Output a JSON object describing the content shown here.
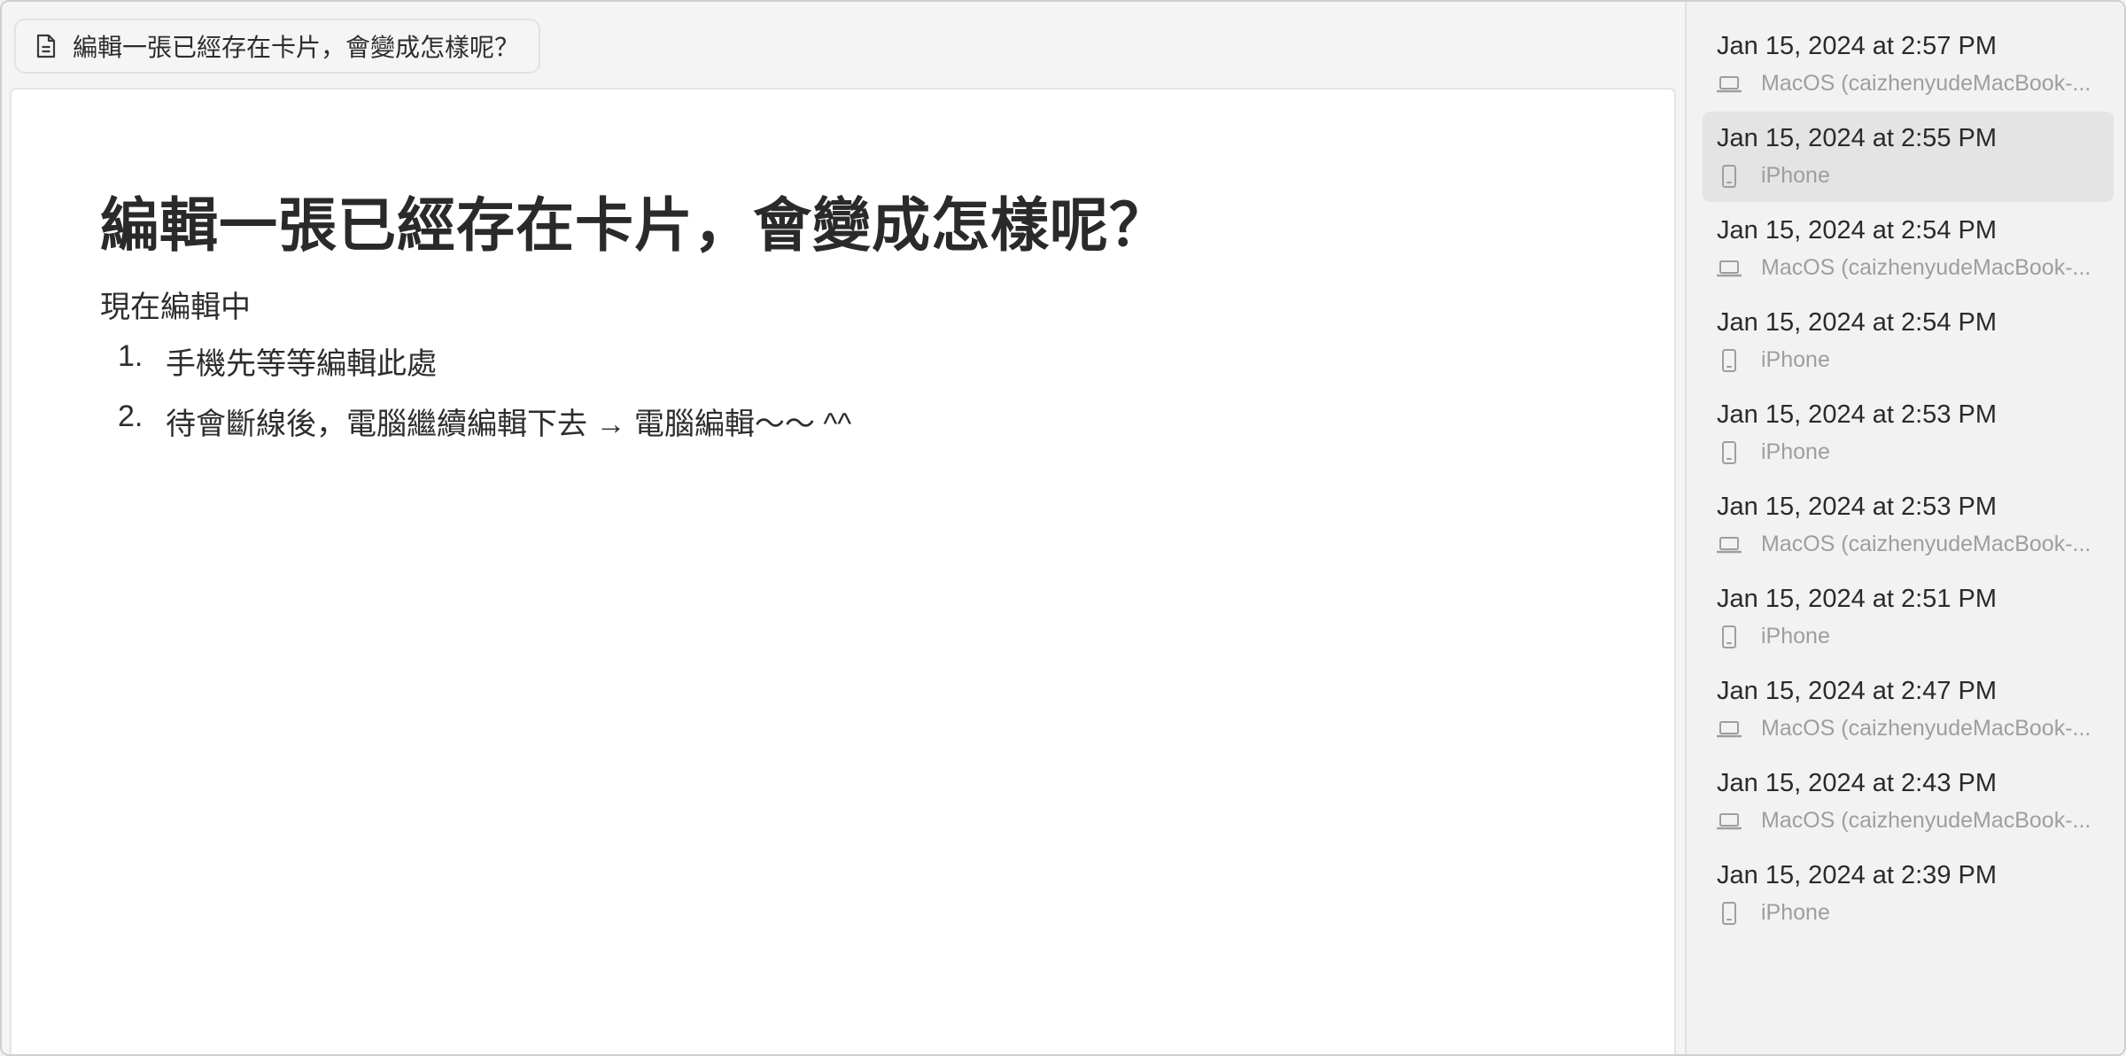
{
  "tab": {
    "title": "編輯一張已經存在卡片，會變成怎樣呢？",
    "icon": "document-icon"
  },
  "document": {
    "title": "編輯一張已經存在卡片，會變成怎樣呢？",
    "paragraph": "現在編輯中",
    "list": [
      {
        "num": "1.",
        "text": "手機先等等編輯此處"
      },
      {
        "num": "2.",
        "text": "待會斷線後，電腦繼續編輯下去 → 電腦編輯～～ ^^"
      }
    ]
  },
  "versions": [
    {
      "date": "Jan 15, 2024 at 2:57 PM",
      "device": "MacOS (caizhenyudeMacBook-...",
      "device_icon": "laptop-icon",
      "selected": false
    },
    {
      "date": "Jan 15, 2024 at 2:55 PM",
      "device": "iPhone",
      "device_icon": "phone-icon",
      "selected": true
    },
    {
      "date": "Jan 15, 2024 at 2:54 PM",
      "device": "MacOS (caizhenyudeMacBook-...",
      "device_icon": "laptop-icon",
      "selected": false
    },
    {
      "date": "Jan 15, 2024 at 2:54 PM",
      "device": "iPhone",
      "device_icon": "phone-icon",
      "selected": false
    },
    {
      "date": "Jan 15, 2024 at 2:53 PM",
      "device": "iPhone",
      "device_icon": "phone-icon",
      "selected": false
    },
    {
      "date": "Jan 15, 2024 at 2:53 PM",
      "device": "MacOS (caizhenyudeMacBook-...",
      "device_icon": "laptop-icon",
      "selected": false
    },
    {
      "date": "Jan 15, 2024 at 2:51 PM",
      "device": "iPhone",
      "device_icon": "phone-icon",
      "selected": false
    },
    {
      "date": "Jan 15, 2024 at 2:47 PM",
      "device": "MacOS (caizhenyudeMacBook-...",
      "device_icon": "laptop-icon",
      "selected": false
    },
    {
      "date": "Jan 15, 2024 at 2:43 PM",
      "device": "MacOS (caizhenyudeMacBook-...",
      "device_icon": "laptop-icon",
      "selected": false
    },
    {
      "date": "Jan 15, 2024 at 2:39 PM",
      "device": "iPhone",
      "device_icon": "phone-icon",
      "selected": false
    }
  ],
  "colors": {
    "selected_bg": "#e4e4e4",
    "muted_text": "#9e9e9e"
  }
}
